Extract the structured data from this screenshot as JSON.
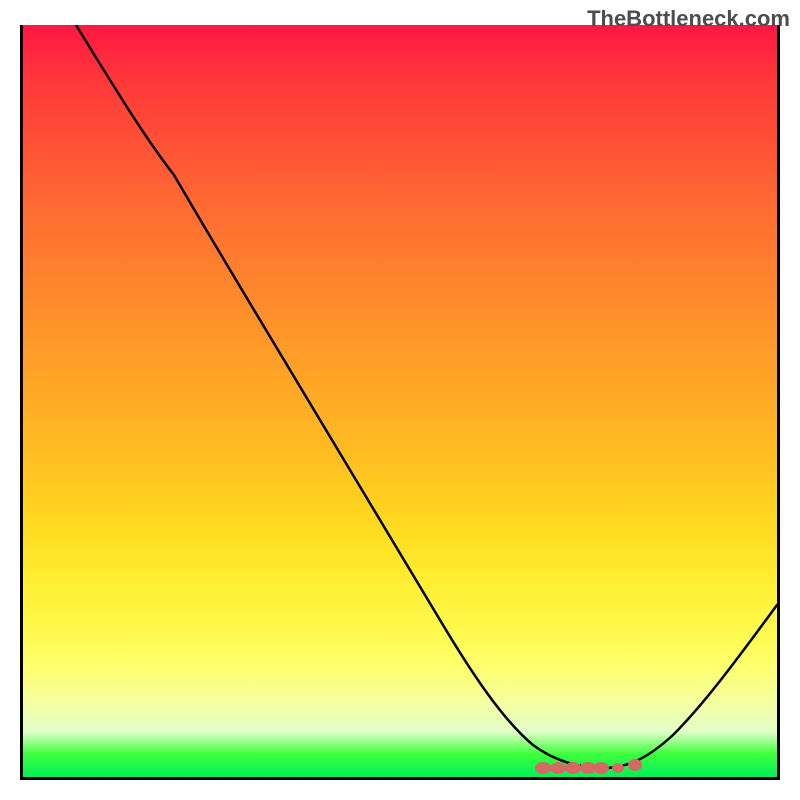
{
  "watermark": "TheBottleneck.com",
  "chart_data": {
    "type": "line",
    "title": "",
    "xlabel": "",
    "ylabel": "",
    "xlim": [
      0,
      100
    ],
    "ylim": [
      0,
      100
    ],
    "series": [
      {
        "name": "curve",
        "x": [
          7,
          10,
          15,
          20,
          25,
          30,
          35,
          40,
          45,
          50,
          55,
          60,
          65,
          70,
          73,
          76,
          80,
          85,
          90,
          95,
          100
        ],
        "y": [
          100,
          95,
          87,
          80,
          74,
          67,
          60,
          52,
          44,
          36,
          28,
          20,
          13,
          6,
          2,
          0,
          0,
          5,
          12,
          20,
          28
        ]
      },
      {
        "name": "bottom-marker",
        "type": "scatter",
        "x": [
          70,
          71,
          72,
          73,
          74,
          76,
          78,
          80,
          82,
          83
        ],
        "y": [
          0.5,
          0.5,
          0.5,
          0.5,
          0.5,
          0.5,
          0.5,
          0.5,
          0.5,
          0.5
        ]
      }
    ],
    "gradient_background": {
      "top": "#ff1744",
      "middle": "#ffcc20",
      "bottom": "#01ef5c"
    }
  }
}
